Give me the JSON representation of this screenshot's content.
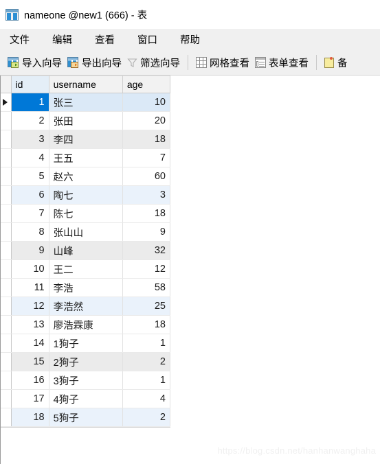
{
  "window": {
    "title": "nameone @new1 (666) - 表",
    "icon": "table-icon"
  },
  "menubar": {
    "items": [
      {
        "label": "文件"
      },
      {
        "label": "编辑"
      },
      {
        "label": "查看"
      },
      {
        "label": "窗口"
      },
      {
        "label": "帮助"
      }
    ]
  },
  "toolbar": {
    "import_wizard": "导入向导",
    "export_wizard": "导出向导",
    "filter_wizard": "筛选向导",
    "grid_view": "网格查看",
    "form_view": "表单查看",
    "note_partial": "备"
  },
  "grid": {
    "columns": [
      {
        "key": "id",
        "label": "id",
        "align": "right",
        "sorted": true
      },
      {
        "key": "username",
        "label": "username",
        "align": "left",
        "sorted": false
      },
      {
        "key": "age",
        "label": "age",
        "align": "right",
        "sorted": false
      }
    ],
    "current_row_index": 0,
    "rows": [
      {
        "id": "1",
        "username": "张三",
        "age": "10",
        "tint": "white"
      },
      {
        "id": "2",
        "username": "张田",
        "age": "20",
        "tint": "white"
      },
      {
        "id": "3",
        "username": "李四",
        "age": "18",
        "tint": "gray"
      },
      {
        "id": "4",
        "username": "王五",
        "age": "7",
        "tint": "white"
      },
      {
        "id": "5",
        "username": "赵六",
        "age": "60",
        "tint": "white"
      },
      {
        "id": "6",
        "username": "陶七",
        "age": "3",
        "tint": "blue"
      },
      {
        "id": "7",
        "username": "陈七",
        "age": "18",
        "tint": "white"
      },
      {
        "id": "8",
        "username": "张山山",
        "age": "9",
        "tint": "white"
      },
      {
        "id": "9",
        "username": "山峰",
        "age": "32",
        "tint": "gray"
      },
      {
        "id": "10",
        "username": "王二",
        "age": "12",
        "tint": "white"
      },
      {
        "id": "11",
        "username": "李浩",
        "age": "58",
        "tint": "white"
      },
      {
        "id": "12",
        "username": "李浩然",
        "age": "25",
        "tint": "blue"
      },
      {
        "id": "13",
        "username": "廖浩霖康",
        "age": "18",
        "tint": "white"
      },
      {
        "id": "14",
        "username": "1狗子",
        "age": "1",
        "tint": "white"
      },
      {
        "id": "15",
        "username": "2狗子",
        "age": "2",
        "tint": "gray"
      },
      {
        "id": "16",
        "username": "3狗子",
        "age": "1",
        "tint": "white"
      },
      {
        "id": "17",
        "username": "4狗子",
        "age": "4",
        "tint": "white"
      },
      {
        "id": "18",
        "username": "5狗子",
        "age": "2",
        "tint": "blue"
      }
    ]
  },
  "watermark": {
    "text": "https://blog.csdn.net/hanhanwanghaha"
  },
  "colors": {
    "selection": "#0078d7",
    "row_gray": "#ebebeb",
    "row_blue": "#eaf2fb",
    "chrome": "#f0f0f0"
  }
}
